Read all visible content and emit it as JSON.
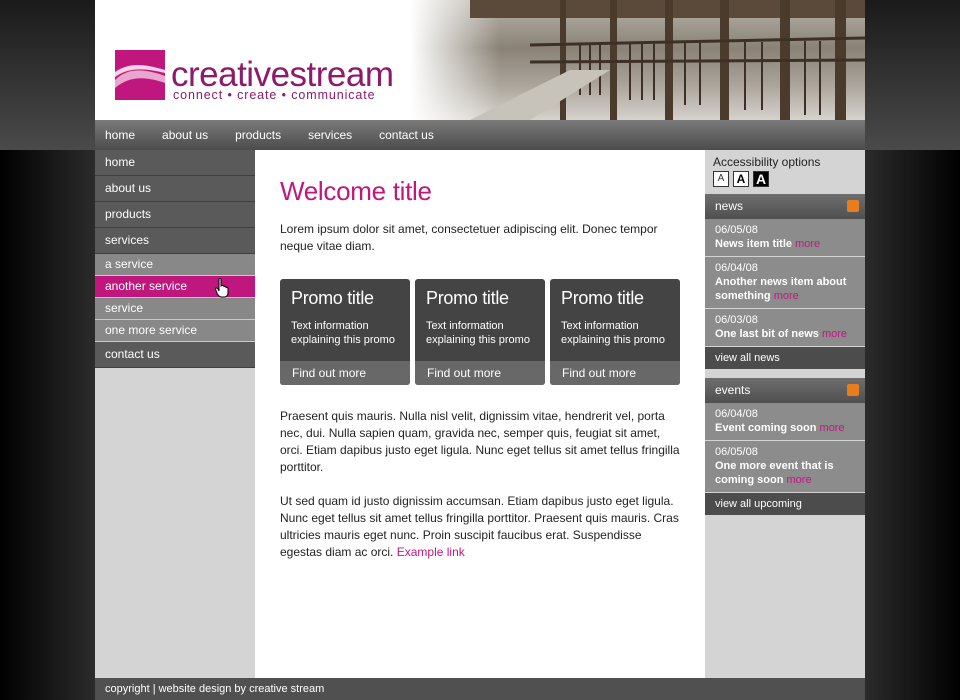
{
  "brand": {
    "name": "creativestream",
    "tagline": "connect • create • communicate",
    "color": "#c0177f"
  },
  "topnav": [
    "home",
    "about us",
    "products",
    "services",
    "contact us"
  ],
  "sidebar": {
    "items_top": [
      "home",
      "about us",
      "products",
      "services"
    ],
    "subitems": [
      "a service",
      "another service",
      "service",
      "one more service"
    ],
    "active_subitem": "another service",
    "items_bottom": [
      "contact us"
    ]
  },
  "main": {
    "title": "Welcome title",
    "intro": "Lorem ipsum dolor sit amet, consectetuer adipiscing elit. Donec tempor neque vitae diam.",
    "promos": [
      {
        "title": "Promo title",
        "text": "Text information explaining this promo",
        "link": "Find out more"
      },
      {
        "title": "Promo title",
        "text": "Text information explaining this promo",
        "link": "Find out more"
      },
      {
        "title": "Promo title",
        "text": "Text information explaining this promo",
        "link": "Find out more"
      }
    ],
    "para1": "Praesent quis mauris. Nulla nisl velit, dignissim vitae, hendrerit vel, porta nec, dui. Nulla sapien quam, gravida nec, semper quis, feugiat sit amet, orci. Etiam dapibus justo eget ligula. Nunc eget tellus sit amet tellus fringilla porttitor.",
    "para2": "Ut sed quam id justo dignissim accumsan. Etiam dapibus justo eget ligula. Nunc eget tellus sit amet tellus fringilla porttitor. Praesent quis mauris. Cras ultricies mauris eget nunc. Proin suscipit faucibus erat. Suspendisse egestas diam ac orci.",
    "example_link": "Example link"
  },
  "accessibility": {
    "label": "Accessibility options",
    "buttons": [
      "A",
      "A",
      "A"
    ]
  },
  "news": {
    "heading": "news",
    "items": [
      {
        "date": "06/05/08",
        "title": "News item title",
        "more": "more"
      },
      {
        "date": "06/04/08",
        "title": "Another news item about something",
        "more": "more"
      },
      {
        "date": "06/03/08",
        "title": "One last bit of news",
        "more": "more"
      }
    ],
    "view_all": "view all news"
  },
  "events": {
    "heading": "events",
    "items": [
      {
        "date": "06/04/08",
        "title": "Event coming soon",
        "more": "more"
      },
      {
        "date": "06/05/08",
        "title": "One more event that is coming soon",
        "more": "more"
      }
    ],
    "view_all": "view all upcoming"
  },
  "footer": "copyright | website design by creative stream"
}
